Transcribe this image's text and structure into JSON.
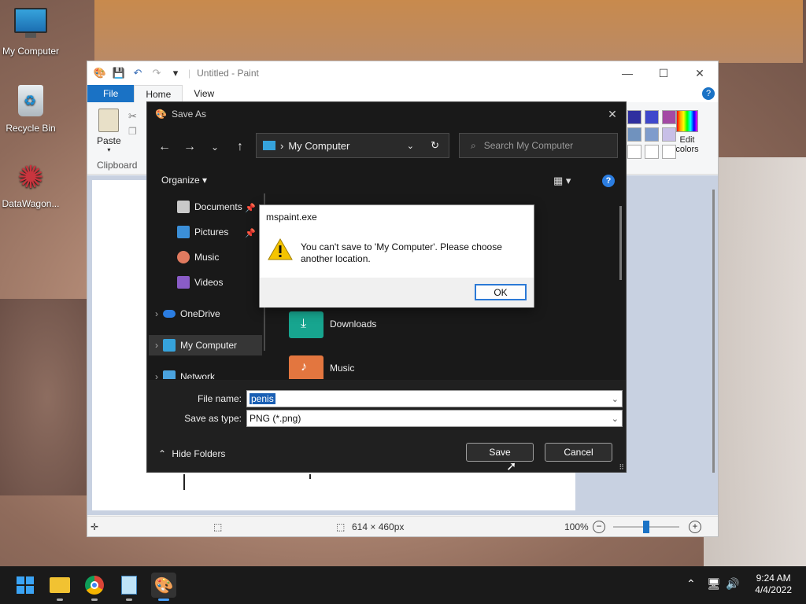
{
  "desktop": {
    "icons": [
      {
        "label": "My Computer"
      },
      {
        "label": "Recycle Bin"
      },
      {
        "label": "DataWagon..."
      }
    ]
  },
  "paint": {
    "title": "Untitled - Paint",
    "tabs": {
      "file": "File",
      "home": "Home",
      "view": "View"
    },
    "paste_label": "Paste",
    "clipboard_label": "Clipboard",
    "edit_colors_label": "Edit colors",
    "palette": [
      "#2f2f9f",
      "#3f48cc",
      "#a349a4",
      "#7092be",
      "#7f9ccc",
      "#c8bfe7",
      "#ffffff",
      "#ffffff",
      "#ffffff"
    ],
    "status": {
      "size": "614 × 460px",
      "zoom": "100%"
    }
  },
  "save_as": {
    "title": "Save As",
    "address": "My Computer",
    "search_placeholder": "Search My Computer",
    "organize": "Organize",
    "nav": {
      "documents": "Documents",
      "pictures": "Pictures",
      "music": "Music",
      "videos": "Videos",
      "onedrive": "OneDrive",
      "my_computer": "My Computer",
      "network": "Network"
    },
    "files": {
      "downloads": "Downloads",
      "music": "Music"
    },
    "file_name_label": "File name:",
    "file_name_value": "penis",
    "save_type_label": "Save as type:",
    "save_type_value": "PNG (*.png)",
    "hide_folders": "Hide Folders",
    "save": "Save",
    "cancel": "Cancel"
  },
  "message_box": {
    "title": "mspaint.exe",
    "text": "You can't save to 'My Computer'. Please choose another location.",
    "ok": "OK"
  },
  "taskbar": {
    "time": "9:24 AM",
    "date": "4/4/2022"
  }
}
